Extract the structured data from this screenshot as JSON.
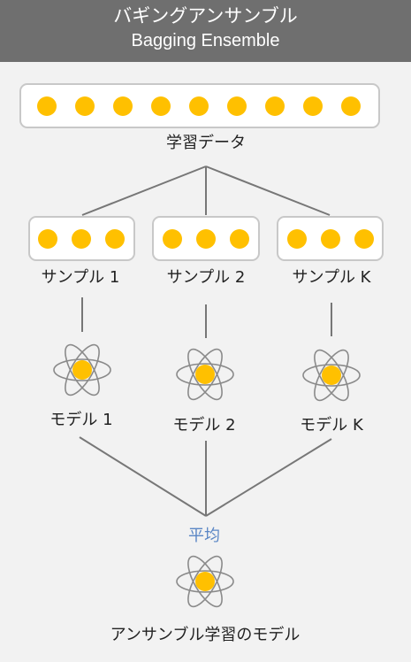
{
  "header": {
    "title_jp": "バギングアンサンブル",
    "title_en": "Bagging Ensemble"
  },
  "training_data": {
    "label": "学習データ",
    "dot_count": 9
  },
  "samples": [
    {
      "label": "サンプル 1",
      "dot_count": 3
    },
    {
      "label": "サンプル 2",
      "dot_count": 3
    },
    {
      "label": "サンプル K",
      "dot_count": 3
    }
  ],
  "models": [
    {
      "label": "モデル 1",
      "icon": "atom-icon"
    },
    {
      "label": "モデル 2",
      "icon": "atom-icon"
    },
    {
      "label": "モデル K",
      "icon": "atom-icon"
    }
  ],
  "aggregation": {
    "label": "平均"
  },
  "ensemble_model": {
    "label": "アンサンブル学習のモデル",
    "icon": "atom-icon"
  },
  "colors": {
    "header_bg": "#6f6f6f",
    "dot": "#ffc000",
    "box_stroke": "#c8c8c8",
    "line": "#777777",
    "average_text": "#5a86c5"
  }
}
